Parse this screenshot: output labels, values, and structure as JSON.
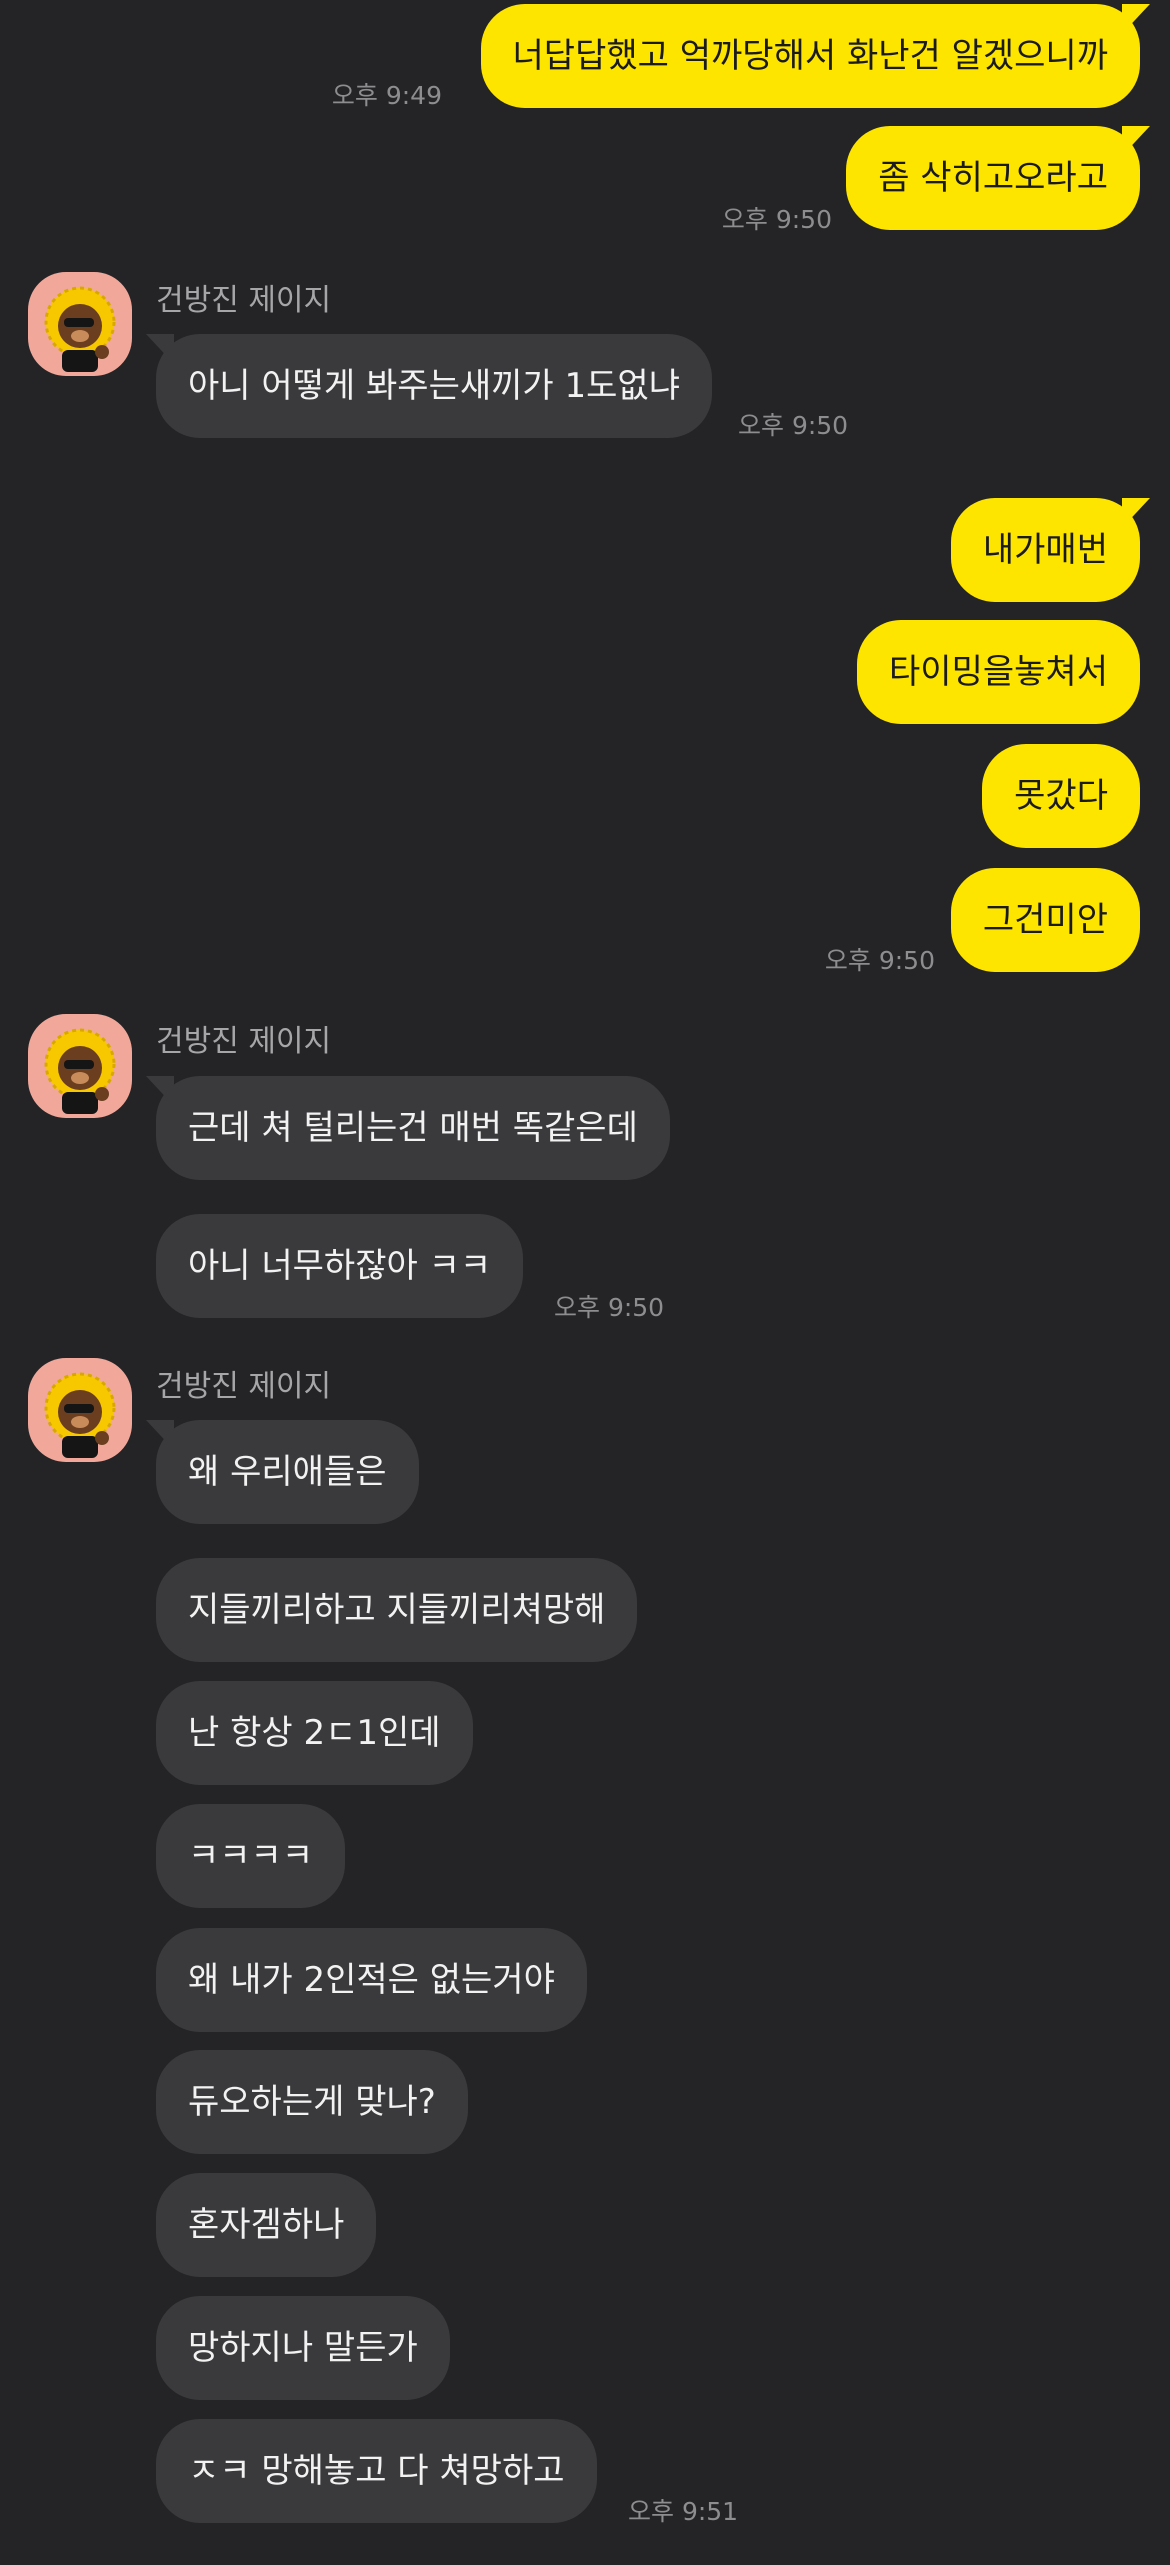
{
  "sender_name": "건방진 제이지",
  "outgoing_1": {
    "messages": [
      "너답답했고 억까당해서 화난건 알겠으니까"
    ],
    "time": "오후 9:49"
  },
  "outgoing_2": {
    "messages": [
      "좀 삭히고오라고"
    ],
    "time": "오후 9:50"
  },
  "incoming_1": {
    "messages": [
      "아니 어떻게 봐주는새끼가 1도없냐"
    ],
    "time": "오후 9:50"
  },
  "outgoing_3": {
    "messages": [
      "내가매번",
      "타이밍을놓쳐서",
      "못갔다",
      "그건미안"
    ],
    "time": "오후 9:50"
  },
  "incoming_2": {
    "messages": [
      "근데 쳐 털리는건 매번 똑같은데",
      "아니 너무하잖아 ㅋㅋ"
    ],
    "time": "오후 9:50"
  },
  "incoming_3": {
    "messages": [
      "왜 우리애들은",
      "지들끼리하고 지들끼리쳐망해",
      "난 항상 2ㄷ1인데",
      "ㅋㅋㅋㅋ",
      "왜 내가 2인적은 없는거야",
      "듀오하는게 맞나?",
      "혼자겜하나",
      "망하지나 말든가",
      "ㅈㅋ 망해놓고 다 쳐망하고"
    ],
    "time": "오후 9:51"
  },
  "colors": {
    "background": "#242426",
    "my_bubble": "#fee500",
    "their_bubble": "#3a3a3d",
    "avatar_bg": "#f1a89b"
  },
  "icons": {
    "avatar": "kakao-jay-g-character-icon"
  }
}
